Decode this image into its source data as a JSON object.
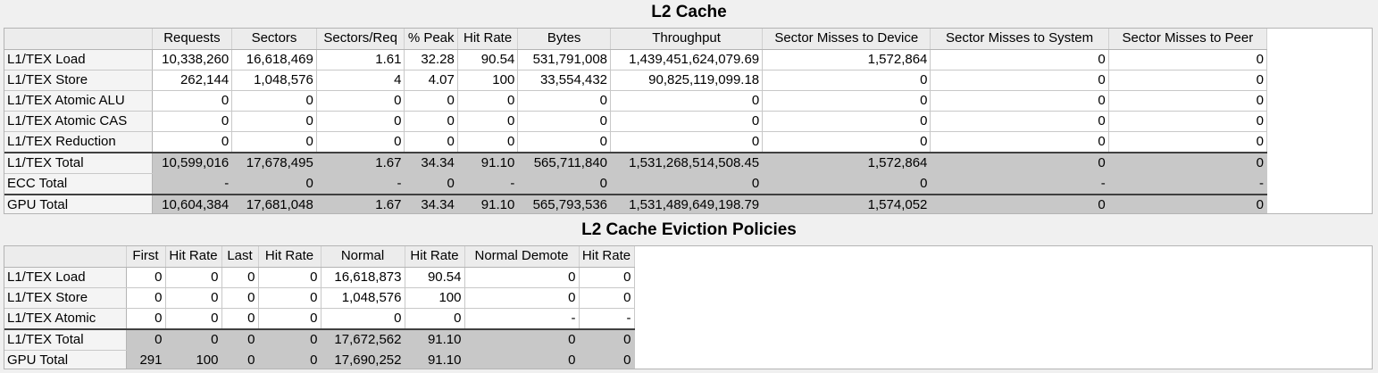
{
  "l2_cache": {
    "title": "L2 Cache",
    "columns": [
      "Requests",
      "Sectors",
      "Sectors/Req",
      "% Peak",
      "Hit Rate",
      "Bytes",
      "Throughput",
      "Sector Misses to Device",
      "Sector Misses to System",
      "Sector Misses to Peer"
    ],
    "rows": [
      {
        "label": "L1/TEX Load",
        "cells": [
          "10,338,260",
          "16,618,469",
          "1.61",
          "32.28",
          "90.54",
          "531,791,008",
          "1,439,451,624,079.69",
          "1,572,864",
          "0",
          "0"
        ]
      },
      {
        "label": "L1/TEX Store",
        "cells": [
          "262,144",
          "1,048,576",
          "4",
          "4.07",
          "100",
          "33,554,432",
          "90,825,119,099.18",
          "0",
          "0",
          "0"
        ]
      },
      {
        "label": "L1/TEX Atomic ALU",
        "cells": [
          "0",
          "0",
          "0",
          "0",
          "0",
          "0",
          "0",
          "0",
          "0",
          "0"
        ]
      },
      {
        "label": "L1/TEX Atomic CAS",
        "cells": [
          "0",
          "0",
          "0",
          "0",
          "0",
          "0",
          "0",
          "0",
          "0",
          "0"
        ]
      },
      {
        "label": "L1/TEX Reduction",
        "cells": [
          "0",
          "0",
          "0",
          "0",
          "0",
          "0",
          "0",
          "0",
          "0",
          "0"
        ]
      },
      {
        "label": "L1/TEX Total",
        "cells": [
          "10,599,016",
          "17,678,495",
          "1.67",
          "34.34",
          "91.10",
          "565,711,840",
          "1,531,268,514,508.45",
          "1,572,864",
          "0",
          "0"
        ]
      },
      {
        "label": "ECC Total",
        "cells": [
          "-",
          "0",
          "-",
          "0",
          "-",
          "0",
          "0",
          "0",
          "-",
          "-"
        ]
      },
      {
        "label": "GPU Total",
        "cells": [
          "10,604,384",
          "17,681,048",
          "1.67",
          "34.34",
          "91.10",
          "565,793,536",
          "1,531,489,649,198.79",
          "1,574,052",
          "0",
          "0"
        ]
      }
    ]
  },
  "eviction": {
    "title": "L2 Cache Eviction Policies",
    "columns": [
      "First",
      "Hit Rate",
      "Last",
      "Hit Rate",
      "Normal",
      "Hit Rate",
      "Normal Demote",
      "Hit Rate"
    ],
    "rows": [
      {
        "label": "L1/TEX Load",
        "cells": [
          "0",
          "0",
          "0",
          "0",
          "16,618,873",
          "90.54",
          "0",
          "0"
        ]
      },
      {
        "label": "L1/TEX Store",
        "cells": [
          "0",
          "0",
          "0",
          "0",
          "1,048,576",
          "100",
          "0",
          "0"
        ]
      },
      {
        "label": "L1/TEX Atomic",
        "cells": [
          "0",
          "0",
          "0",
          "0",
          "0",
          "0",
          "-",
          "-"
        ]
      },
      {
        "label": "L1/TEX Total",
        "cells": [
          "0",
          "0",
          "0",
          "0",
          "17,672,562",
          "91.10",
          "0",
          "0"
        ]
      },
      {
        "label": "GPU Total",
        "cells": [
          "291",
          "100",
          "0",
          "0",
          "17,690,252",
          "91.10",
          "0",
          "0"
        ]
      }
    ]
  }
}
